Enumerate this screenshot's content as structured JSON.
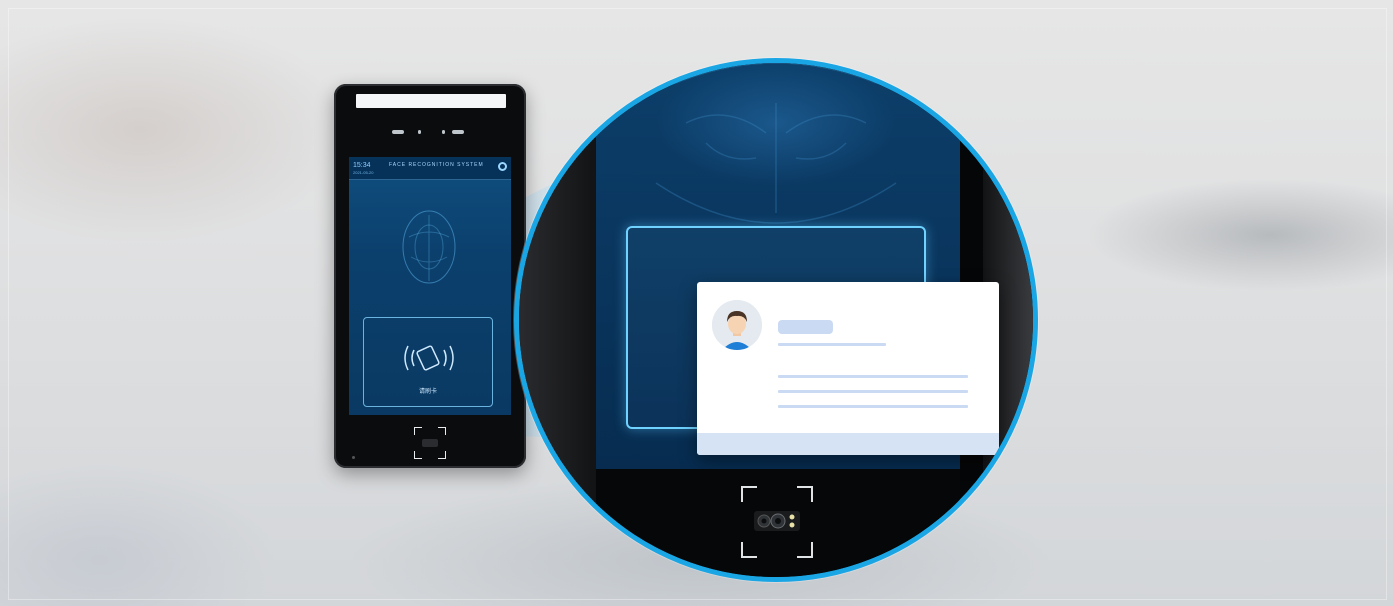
{
  "device": {
    "screen_title": "FACE RECOGNITION SYSTEM",
    "time": "15:34",
    "date": "2021-05-20",
    "card_prompt": "请刷卡",
    "icons": [
      "gear-icon",
      "card-swipe-icon",
      "camera-icon"
    ]
  },
  "zoom": {
    "border_color": "#1aa6e4",
    "icons": [
      "user-avatar-icon",
      "dual-camera-icon"
    ]
  },
  "colors": {
    "accent": "#1aa6e4",
    "screen": "#0b3f6c",
    "card_bar": "#c9daf2"
  }
}
